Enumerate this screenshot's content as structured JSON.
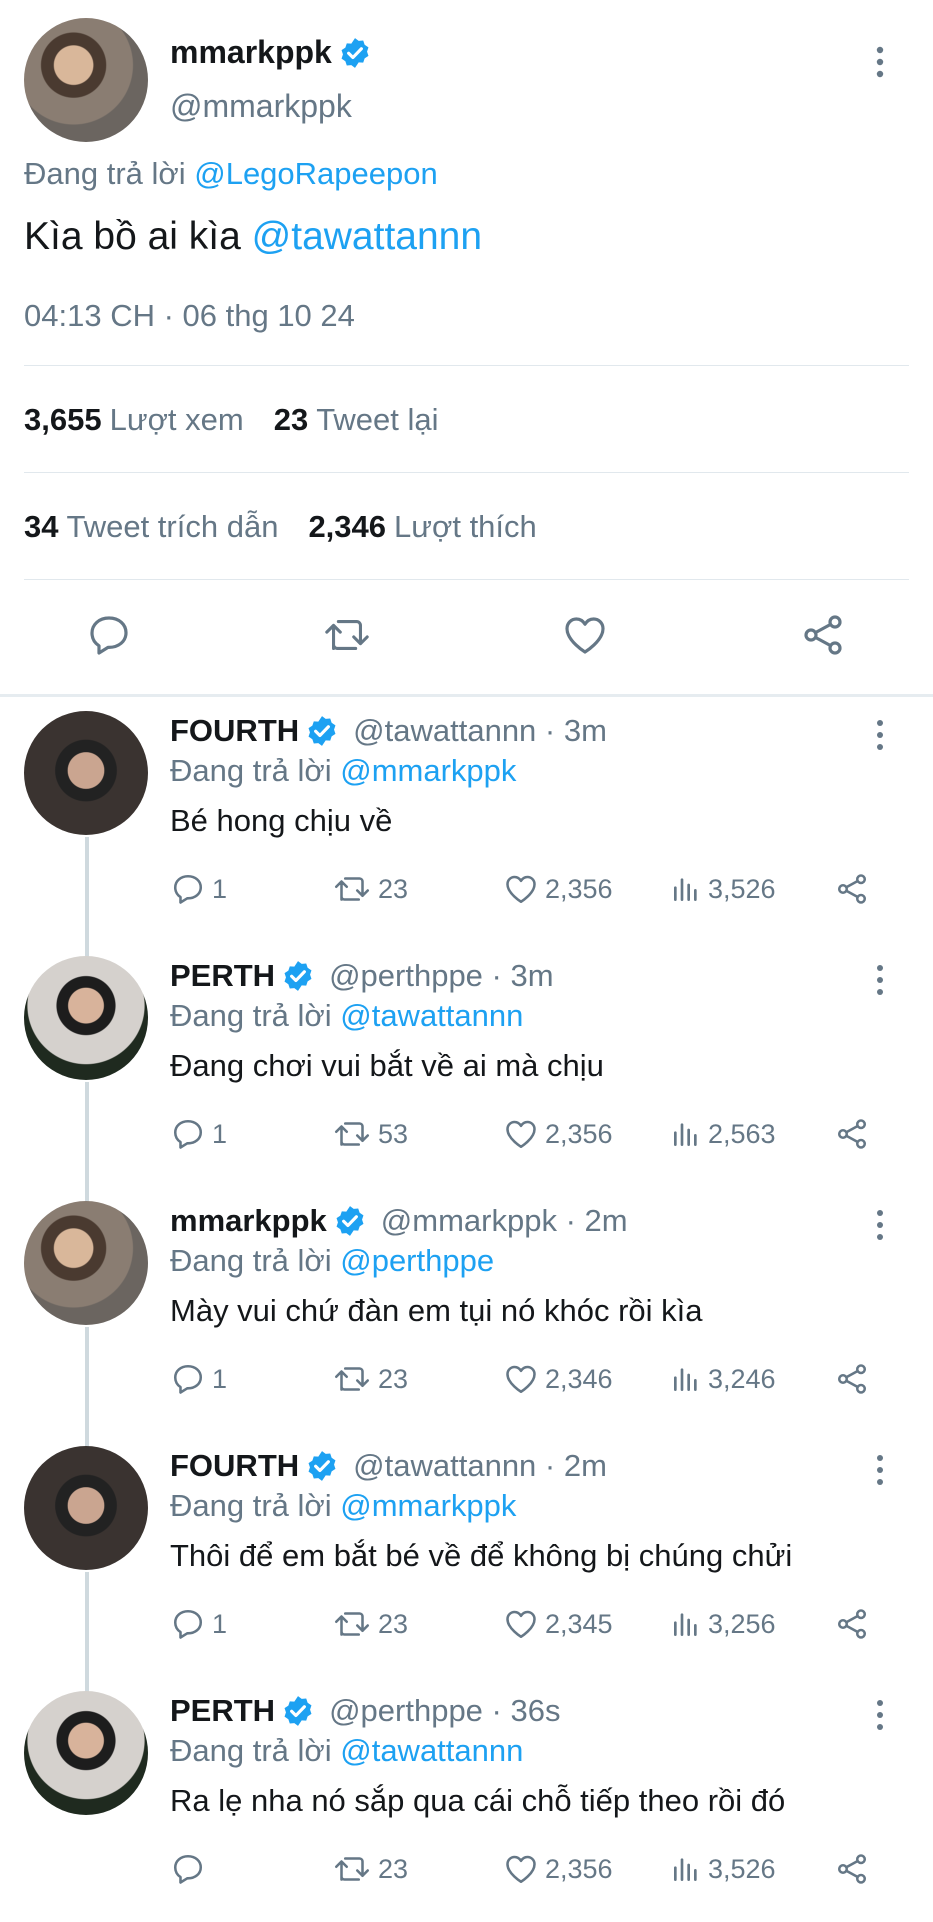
{
  "main_tweet": {
    "name": "mmarkppk",
    "handle": "@mmarkppk",
    "replying_prefix": "Đang trả lời ",
    "replying_to": "@LegoRapeepon",
    "text_before": "Kìa bồ ai kìa ",
    "text_mention": "@tawattannn",
    "timestamp": "04:13 CH · 06 thg 10 24",
    "views_count": "3,655",
    "views_label": "Lượt xem",
    "retweets_count": "23",
    "retweets_label": "Tweet lại",
    "quotes_count": "34",
    "quotes_label": "Tweet trích dẫn",
    "likes_count": "2,346",
    "likes_label": "Lượt thích"
  },
  "replies": [
    {
      "name": "FOURTH",
      "handle": "@tawattannn · 3m",
      "replying_prefix": "Đang trả lời ",
      "replying_to": "@mmarkppk",
      "text": "Bé hong chịu về",
      "replies": "1",
      "retweets": "23",
      "likes": "2,356",
      "views": "3,526"
    },
    {
      "name": "PERTH",
      "handle": "@perthppe · 3m",
      "replying_prefix": "Đang trả lời ",
      "replying_to": "@tawattannn",
      "text": "Đang chơi vui bắt về ai mà chịu",
      "replies": "1",
      "retweets": "53",
      "likes": "2,356",
      "views": "2,563"
    },
    {
      "name": "mmarkppk",
      "handle": "@mmarkppk · 2m",
      "replying_prefix": "Đang trả lời ",
      "replying_to": "@perthppe",
      "text": "Mày vui chứ đàn em tụi nó khóc rồi kìa",
      "replies": "1",
      "retweets": "23",
      "likes": "2,346",
      "views": "3,246"
    },
    {
      "name": "FOURTH",
      "handle": "@tawattannn · 2m",
      "replying_prefix": "Đang trả lời ",
      "replying_to": "@mmarkppk",
      "text": "Thôi để em bắt bé về để không bị chúng chửi",
      "replies": "1",
      "retweets": "23",
      "likes": "2,345",
      "views": "3,256"
    },
    {
      "name": "PERTH",
      "handle": "@perthppe · 36s",
      "replying_prefix": "Đang trả lời ",
      "replying_to": "@tawattannn",
      "text": "Ra lẹ nha nó sắp qua cái chỗ tiếp theo rồi đó",
      "replies": "",
      "retweets": "23",
      "likes": "2,356",
      "views": "3,526"
    }
  ],
  "colors": {
    "accent": "#1da1f2",
    "muted": "#657786",
    "text": "#14171a",
    "divider": "#e1e8ed"
  },
  "icons": [
    "verified-badge-icon",
    "more-vertical-icon",
    "reply-icon",
    "retweet-icon",
    "like-icon",
    "share-icon",
    "views-icon"
  ]
}
